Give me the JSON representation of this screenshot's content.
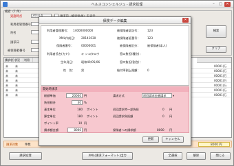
{
  "window": {
    "title": "ヘルスコンシェルジュ - 請求処理"
  },
  "search": {
    "group_label": "検索（7 件）",
    "ins_no_label": "実施時点",
    "ins_no_label_value": "2014.4",
    "checkbox_label": "請求前（検索条件）を表示",
    "provider_label": "利用者管理番号",
    "name_label": "氏名",
    "claim_label": "請求日",
    "insured_label": "被保険者番号",
    "search_button": "検索",
    "clear_button": "クリア"
  },
  "table": {
    "headers": [
      "請求状態",
      "状況",
      "利用",
      "",
      "",
      "",
      "",
      ""
    ],
    "rows": [
      [
        "未",
        "未",
        "",
        "",
        "",
        "",
        "",
        "00001(万"
      ],
      [
        "未",
        "未",
        "",
        "",
        "",
        "",
        "",
        "00001(万"
      ],
      [
        "未",
        "未",
        "",
        "",
        "",
        "",
        "",
        "00001(万"
      ],
      [
        "未",
        "未",
        "",
        "",
        "",
        "",
        "",
        "00001(万"
      ],
      [
        "未",
        "未",
        "",
        "",
        "",
        "",
        "",
        "00001(万"
      ],
      [
        "未",
        "未",
        "",
        "",
        "",
        "",
        "",
        "00001(万"
      ],
      [
        "未",
        "未",
        "",
        "",
        "",
        "",
        "",
        "00001(万"
      ]
    ]
  },
  "bottom_bar": {
    "label": "請求対象",
    "count_label": "件数",
    "total_value": "8000 円"
  },
  "footer_buttons": [
    "請求処理",
    "XML(請求フォーマット)出力",
    "全選択",
    "解除",
    "閉じる"
  ],
  "dialog": {
    "title": "保険データ編集",
    "info": {
      "manage_no_label": "利用者管理番号：",
      "manage_no_value": "14000000000",
      "insurer_no_label": "被保険者証記号：",
      "insurer_no_value": "123",
      "xml_date_label": "XML作成日：",
      "xml_date_value": "20141030",
      "insured_no_label": "被保険者証番号：",
      "insured_no_value": "123",
      "ins_no_label": "保険者番号：",
      "ins_no_value": "00000001",
      "ins_type_label": "被保険者区分：",
      "ins_type_value": "被保険者(本人)",
      "kana_label": "利用者氏名(カナ)：",
      "kana_value": "キ ンコタロウ",
      "clinic_label": "窓口負担(種別)：",
      "clinic_value": "",
      "birth_label": "生年月日：",
      "birth_value": "昭和49/05/06",
      "share_label": "窓口負担(割合)：",
      "share_value": "",
      "sex_label": "性　別：",
      "sex_value": "男",
      "limit_label": "給付率割上限額：",
      "limit_value": "0"
    },
    "billing": {
      "head": "開始時請求",
      "r1_label": "総額単価",
      "r1_value": "20000",
      "r1_unit": "円",
      "r1_right_label": "請求方式",
      "r1_select": "初回請求金額請求",
      "r2_label": "負担割合",
      "r2_value": "40",
      "r2_unit": "%",
      "r3_label": "基本単位",
      "r3_value": "180",
      "r3_unit": "ポイント",
      "r3_right_label": "初回請求時一部負担",
      "r3_right_value": "0",
      "r3_right_unit": "円",
      "r4_label": "算定単位",
      "r4_value": "180",
      "r4_unit": "ポイント",
      "r4_right_label": "初回請求負担額",
      "r4_right_value": "0",
      "r4_right_unit": "円",
      "r5_label": "ポイント率",
      "r5_value": "10",
      "r5_unit": "円",
      "r6_label": "請求額金額",
      "r6_value": "8000",
      "r6_unit": "円",
      "r6_right_label": "保険者への請求額",
      "r6_right_value": "8000",
      "r6_right_unit": "円"
    },
    "update_button": "更新",
    "cancel_button": "キャンセル"
  }
}
